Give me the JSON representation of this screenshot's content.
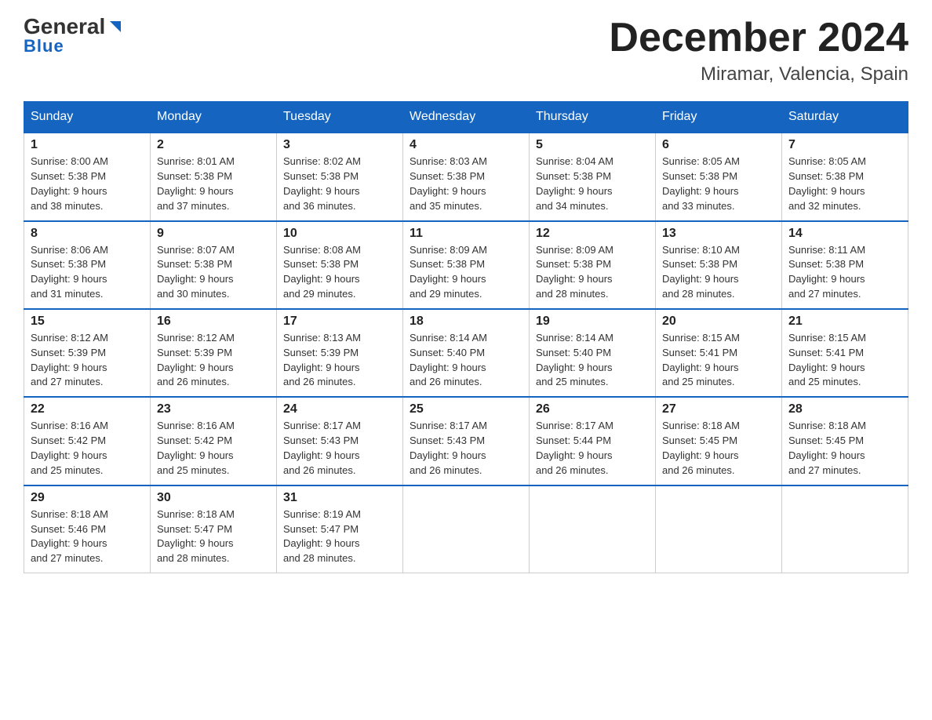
{
  "header": {
    "logo_general": "General",
    "logo_blue": "Blue",
    "month_year": "December 2024",
    "location": "Miramar, Valencia, Spain"
  },
  "days_of_week": [
    "Sunday",
    "Monday",
    "Tuesday",
    "Wednesday",
    "Thursday",
    "Friday",
    "Saturday"
  ],
  "weeks": [
    [
      {
        "day": "1",
        "sunrise": "8:00 AM",
        "sunset": "5:38 PM",
        "daylight": "9 hours and 38 minutes."
      },
      {
        "day": "2",
        "sunrise": "8:01 AM",
        "sunset": "5:38 PM",
        "daylight": "9 hours and 37 minutes."
      },
      {
        "day": "3",
        "sunrise": "8:02 AM",
        "sunset": "5:38 PM",
        "daylight": "9 hours and 36 minutes."
      },
      {
        "day": "4",
        "sunrise": "8:03 AM",
        "sunset": "5:38 PM",
        "daylight": "9 hours and 35 minutes."
      },
      {
        "day": "5",
        "sunrise": "8:04 AM",
        "sunset": "5:38 PM",
        "daylight": "9 hours and 34 minutes."
      },
      {
        "day": "6",
        "sunrise": "8:05 AM",
        "sunset": "5:38 PM",
        "daylight": "9 hours and 33 minutes."
      },
      {
        "day": "7",
        "sunrise": "8:05 AM",
        "sunset": "5:38 PM",
        "daylight": "9 hours and 32 minutes."
      }
    ],
    [
      {
        "day": "8",
        "sunrise": "8:06 AM",
        "sunset": "5:38 PM",
        "daylight": "9 hours and 31 minutes."
      },
      {
        "day": "9",
        "sunrise": "8:07 AM",
        "sunset": "5:38 PM",
        "daylight": "9 hours and 30 minutes."
      },
      {
        "day": "10",
        "sunrise": "8:08 AM",
        "sunset": "5:38 PM",
        "daylight": "9 hours and 29 minutes."
      },
      {
        "day": "11",
        "sunrise": "8:09 AM",
        "sunset": "5:38 PM",
        "daylight": "9 hours and 29 minutes."
      },
      {
        "day": "12",
        "sunrise": "8:09 AM",
        "sunset": "5:38 PM",
        "daylight": "9 hours and 28 minutes."
      },
      {
        "day": "13",
        "sunrise": "8:10 AM",
        "sunset": "5:38 PM",
        "daylight": "9 hours and 28 minutes."
      },
      {
        "day": "14",
        "sunrise": "8:11 AM",
        "sunset": "5:38 PM",
        "daylight": "9 hours and 27 minutes."
      }
    ],
    [
      {
        "day": "15",
        "sunrise": "8:12 AM",
        "sunset": "5:39 PM",
        "daylight": "9 hours and 27 minutes."
      },
      {
        "day": "16",
        "sunrise": "8:12 AM",
        "sunset": "5:39 PM",
        "daylight": "9 hours and 26 minutes."
      },
      {
        "day": "17",
        "sunrise": "8:13 AM",
        "sunset": "5:39 PM",
        "daylight": "9 hours and 26 minutes."
      },
      {
        "day": "18",
        "sunrise": "8:14 AM",
        "sunset": "5:40 PM",
        "daylight": "9 hours and 26 minutes."
      },
      {
        "day": "19",
        "sunrise": "8:14 AM",
        "sunset": "5:40 PM",
        "daylight": "9 hours and 25 minutes."
      },
      {
        "day": "20",
        "sunrise": "8:15 AM",
        "sunset": "5:41 PM",
        "daylight": "9 hours and 25 minutes."
      },
      {
        "day": "21",
        "sunrise": "8:15 AM",
        "sunset": "5:41 PM",
        "daylight": "9 hours and 25 minutes."
      }
    ],
    [
      {
        "day": "22",
        "sunrise": "8:16 AM",
        "sunset": "5:42 PM",
        "daylight": "9 hours and 25 minutes."
      },
      {
        "day": "23",
        "sunrise": "8:16 AM",
        "sunset": "5:42 PM",
        "daylight": "9 hours and 25 minutes."
      },
      {
        "day": "24",
        "sunrise": "8:17 AM",
        "sunset": "5:43 PM",
        "daylight": "9 hours and 26 minutes."
      },
      {
        "day": "25",
        "sunrise": "8:17 AM",
        "sunset": "5:43 PM",
        "daylight": "9 hours and 26 minutes."
      },
      {
        "day": "26",
        "sunrise": "8:17 AM",
        "sunset": "5:44 PM",
        "daylight": "9 hours and 26 minutes."
      },
      {
        "day": "27",
        "sunrise": "8:18 AM",
        "sunset": "5:45 PM",
        "daylight": "9 hours and 26 minutes."
      },
      {
        "day": "28",
        "sunrise": "8:18 AM",
        "sunset": "5:45 PM",
        "daylight": "9 hours and 27 minutes."
      }
    ],
    [
      {
        "day": "29",
        "sunrise": "8:18 AM",
        "sunset": "5:46 PM",
        "daylight": "9 hours and 27 minutes."
      },
      {
        "day": "30",
        "sunrise": "8:18 AM",
        "sunset": "5:47 PM",
        "daylight": "9 hours and 28 minutes."
      },
      {
        "day": "31",
        "sunrise": "8:19 AM",
        "sunset": "5:47 PM",
        "daylight": "9 hours and 28 minutes."
      },
      null,
      null,
      null,
      null
    ]
  ],
  "labels": {
    "sunrise": "Sunrise:",
    "sunset": "Sunset:",
    "daylight": "Daylight:"
  }
}
